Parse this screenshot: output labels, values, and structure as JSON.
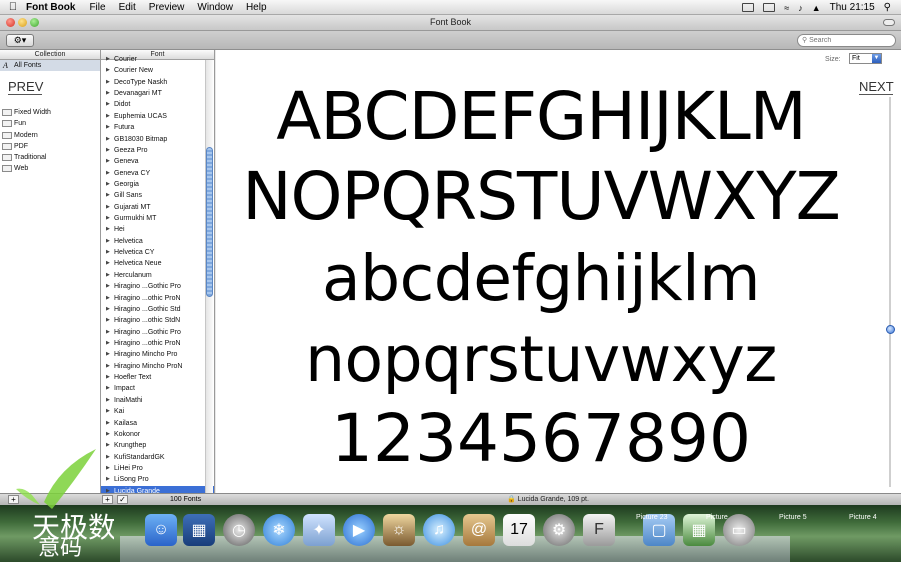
{
  "menubar": {
    "app_name": "Font Book",
    "menus": [
      "File",
      "Edit",
      "Preview",
      "Window",
      "Help"
    ],
    "clock": "Thu 21:15"
  },
  "window": {
    "title": "Font Book"
  },
  "toolbar": {
    "search_placeholder": "Search"
  },
  "collection": {
    "header": "Collection",
    "items": [
      {
        "label": "All Fonts",
        "selected": true
      },
      {
        "label": "Fixed Width"
      },
      {
        "label": "Fun"
      },
      {
        "label": "Modern"
      },
      {
        "label": "PDF"
      },
      {
        "label": "Traditional"
      },
      {
        "label": "Web"
      }
    ]
  },
  "fonts": {
    "header": "Font",
    "items": [
      "Courier",
      "Courier New",
      "DecoType Naskh",
      "Devanagari MT",
      "Didot",
      "Euphemia UCAS",
      "Futura",
      "GB18030 Bitmap",
      "Geeza Pro",
      "Geneva",
      "Geneva CY",
      "Georgia",
      "Gill Sans",
      "Gujarati MT",
      "Gurmukhi MT",
      "Hei",
      "Helvetica",
      "Helvetica CY",
      "Helvetica Neue",
      "Herculanum",
      "Hiragino ...Gothic Pro",
      "Hiragino ...othic ProN",
      "Hiragino ...Gothic Std",
      "Hiragino ...othic StdN",
      "Hiragino ...Gothic Pro",
      "Hiragino ...othic ProN",
      "Hiragino Mincho Pro",
      "Hiragino Mincho ProN",
      "Hoefler Text",
      "Impact",
      "InaiMathi",
      "Kai",
      "Kailasa",
      "Kokonor",
      "Krungthep",
      "KufiStandardGK",
      "LiHei Pro",
      "LiSong Pro",
      "Lucida Grande"
    ],
    "selected": "Lucida Grande"
  },
  "preview": {
    "size_label": "Size:",
    "size_value": "Fit",
    "lines": [
      "ABCDEFGHIJKLM",
      "NOPQRSTUVWXYZ",
      "abcdefghijklm",
      "nopqrstuvwxyz",
      "1234567890"
    ],
    "prev_label": "PREV",
    "next_label": "NEXT"
  },
  "statusbar": {
    "font_count": "100 Fonts",
    "status_text": "Lucida Grande, 109 pt."
  },
  "desktop": {
    "labels": [
      "Picture 23",
      "Picture",
      "Picture 5",
      "Picture 4"
    ],
    "calendar_day": "17"
  }
}
